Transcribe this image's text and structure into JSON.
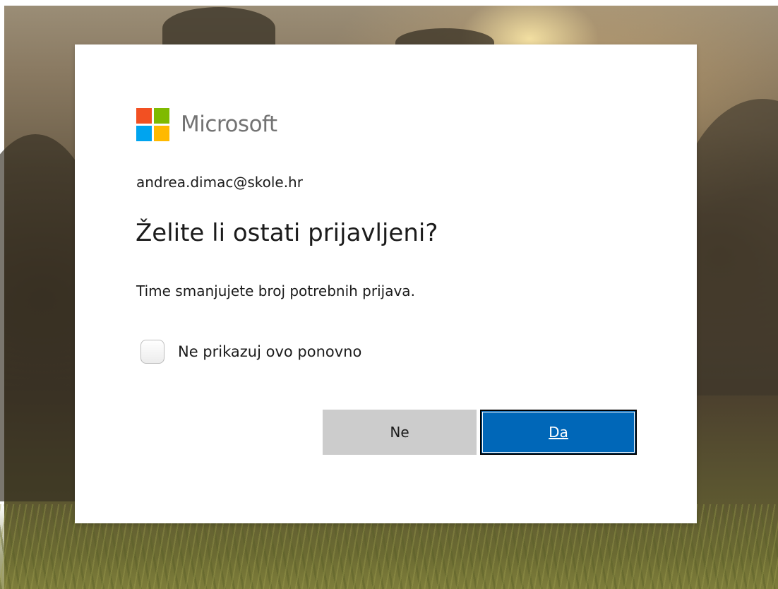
{
  "brand": {
    "name": "Microsoft",
    "logo_colors": [
      "#f25022",
      "#7fba00",
      "#00a4ef",
      "#ffb900"
    ]
  },
  "account": {
    "email": "andrea.dimac@skole.hr"
  },
  "dialog": {
    "title": "Želite li ostati prijavljeni?",
    "description": "Time smanjujete broj potrebnih prijava.",
    "checkbox_label": "Ne prikazuj ovo ponovno",
    "checkbox_checked": false
  },
  "buttons": {
    "no_label": "Ne",
    "yes_label": "Da"
  },
  "colors": {
    "primary_button": "#0067b8",
    "secondary_button": "#cccccc"
  }
}
